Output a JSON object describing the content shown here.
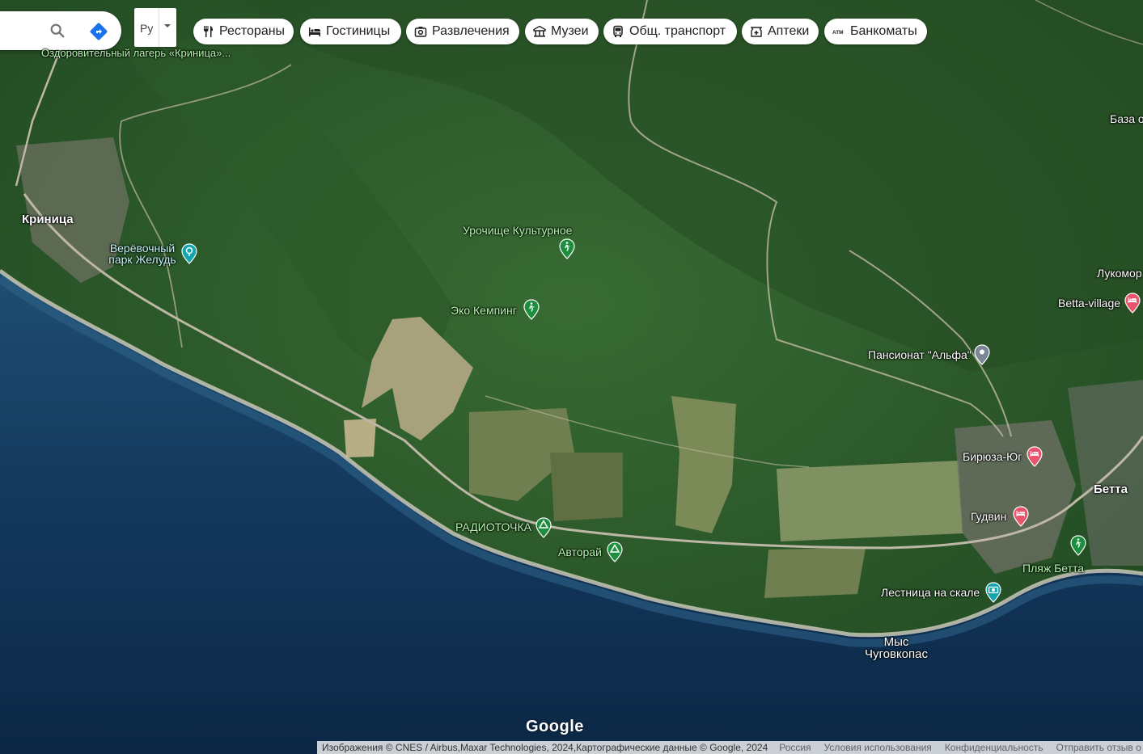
{
  "search": {
    "search_icon": "search-icon",
    "directions_icon": "directions-icon"
  },
  "language": {
    "selected": "Ру",
    "caret_icon": "caret-down-icon"
  },
  "categories": [
    {
      "label": "Рестораны",
      "icon": "fork-knife-icon"
    },
    {
      "label": "Гостиницы",
      "icon": "bed-icon"
    },
    {
      "label": "Развлечения",
      "icon": "camera-icon"
    },
    {
      "label": "Музеи",
      "icon": "museum-icon"
    },
    {
      "label": "Общ. транспорт",
      "icon": "bus-icon"
    },
    {
      "label": "Аптеки",
      "icon": "pharmacy-icon"
    },
    {
      "label": "Банкоматы",
      "icon": "atm-icon"
    }
  ],
  "places": {
    "camp_top": "Оздоровительный лагерь «Криница»...",
    "krinitsa": "Криница",
    "rope_park": "Верёвочный парк Желудь",
    "urochishche": "Урочище Культурное",
    "eco_camping": "Эко Кемпинг",
    "radiotochka": "РАДИОТОЧКА",
    "avtorai": "Авторай",
    "pansionat": "Пансионат \"Альфа\"",
    "baza": "База о",
    "lukomorye": "Лукомор",
    "betta_village": "Betta-village",
    "biryuza": "Бирюза-Юг",
    "gudvin": "Гудвин",
    "betta": "Бетта",
    "betta_beach": "Пляж Бетта",
    "ladder": "Лестница на скале",
    "cape": "Мыс\nЧуговкопас"
  },
  "logo": "Google",
  "footer": {
    "attribution": "Изображения © CNES / Airbus,Maxar Technologies, 2024,Картографические данные © Google, 2024",
    "country": "Россия",
    "terms": "Условия использования",
    "privacy": "Конфиденциальность",
    "feedback": "Отправить отзыв о карте"
  },
  "colors": {
    "sea_deep": "#0e2d4f",
    "sea_shallow": "#1d4a6b",
    "forest": "#2f5f2c",
    "forest_dark": "#234a22",
    "field": "#8a9a66",
    "sand": "#c9c7b6",
    "road": "#b8b2a2",
    "pin_green": "#1e8e3e",
    "pin_pink": "#e8556d",
    "pin_teal": "#12a4af",
    "pin_gray": "#7b8794",
    "directions_blue": "#1a73e8"
  }
}
